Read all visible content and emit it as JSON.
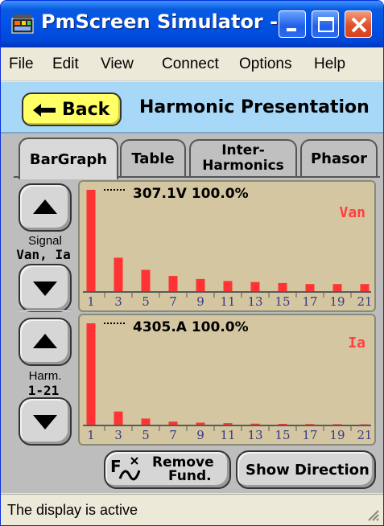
{
  "window": {
    "title": "PmScreen Simulator -...",
    "icon": "pmscreen-app-icon"
  },
  "menu": [
    "File",
    "Edit",
    "View",
    "Connect",
    "Options",
    "Help"
  ],
  "header": {
    "back_label": "Back",
    "title": "Harmonic Presentation"
  },
  "tabs": [
    {
      "lines": [
        "BarGraph"
      ],
      "active": true
    },
    {
      "lines": [
        "Table"
      ],
      "active": false
    },
    {
      "lines": [
        "Inter-",
        "Harmonics"
      ],
      "active": false
    },
    {
      "lines": [
        "Phasor"
      ],
      "active": false
    }
  ],
  "signal_control": {
    "label": "Signal",
    "value": "Van, Ia"
  },
  "harm_control": {
    "label": "Harm.",
    "value": "1-21"
  },
  "chart_data": [
    {
      "type": "bar",
      "readout": "307.1V 100.0%",
      "series_label": "Van",
      "categories": [
        "1",
        "3",
        "5",
        "7",
        "9",
        "11",
        "13",
        "15",
        "17",
        "19",
        "21"
      ],
      "values": [
        100,
        33,
        21,
        15,
        12,
        10,
        9,
        8,
        7,
        7,
        7
      ],
      "ylim": [
        0,
        100
      ],
      "bar_color": "#ff3333",
      "label_color": "#ff4040"
    },
    {
      "type": "bar",
      "readout": "4305.A 100.0%",
      "series_label": "Ia",
      "categories": [
        "1",
        "3",
        "5",
        "7",
        "9",
        "11",
        "13",
        "15",
        "17",
        "19",
        "21"
      ],
      "values": [
        100,
        13,
        6,
        3,
        2,
        1.5,
        1,
        0.8,
        0.6,
        0.5,
        0.4
      ],
      "ylim": [
        0,
        100
      ],
      "bar_color": "#ff3333",
      "label_color": "#ff4040"
    }
  ],
  "buttons": {
    "remove_fund_line1": "Remove",
    "remove_fund_line2": "Fund.",
    "show_direction": "Show Direction"
  },
  "status": "The display is active",
  "colors": {
    "titlebar": "#0253e6",
    "header_band": "#a8d8f8",
    "back_button": "#ffff66",
    "chart_bg": "#d3c6a0",
    "bar": "#ff3333"
  }
}
